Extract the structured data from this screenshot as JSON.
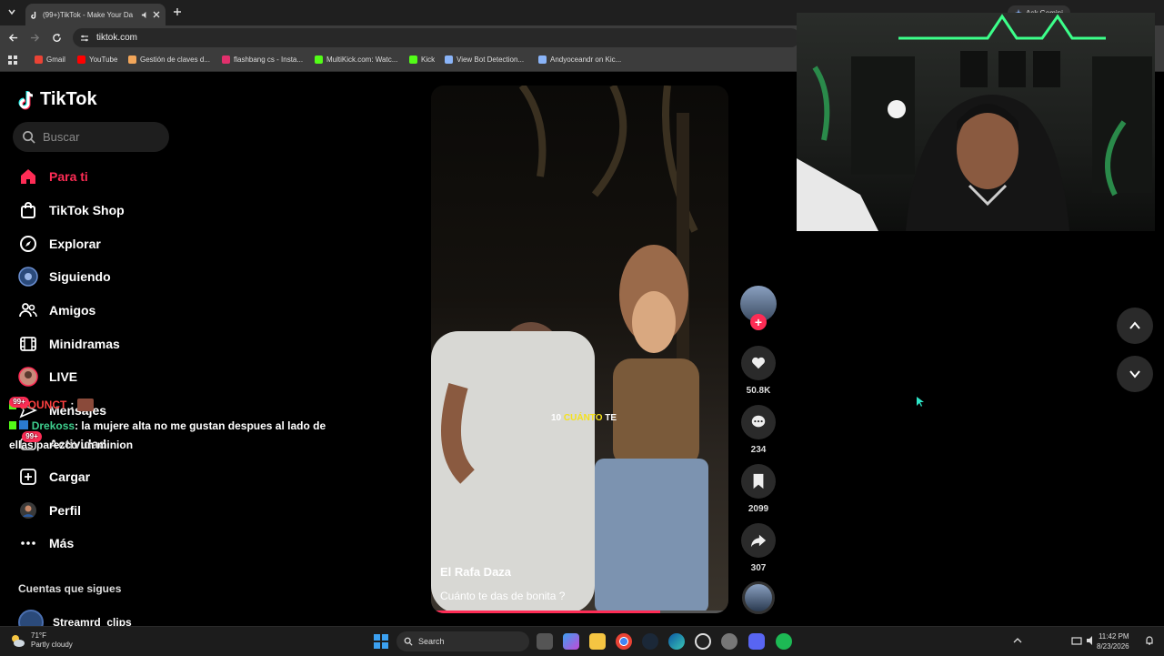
{
  "browser": {
    "tab_title": "(99+)TikTok - Make Your Da",
    "url": "tiktok.com",
    "ask_gemini": "Ask Gemini",
    "bookmarks": [
      {
        "label": "Gmail",
        "color": "#ea4335"
      },
      {
        "label": "YouTube",
        "color": "#ff0000"
      },
      {
        "label": "Gestión de claves d...",
        "color": "#f2a65a"
      },
      {
        "label": "flashbang cs - Insta...",
        "color": "#e1306c"
      },
      {
        "label": "MultiKick.com: Watc...",
        "color": "#53fc18"
      },
      {
        "label": "Kick",
        "color": "#53fc18"
      },
      {
        "label": "View Bot Detection...",
        "color": "#8ab4f8"
      },
      {
        "label": "Andyoceandr on Kic...",
        "color": "#8ab4f8"
      }
    ]
  },
  "sidebar": {
    "logo": "TikTok",
    "search_placeholder": "Buscar",
    "nav": [
      {
        "label": "Para ti",
        "icon": "home-icon"
      },
      {
        "label": "TikTok Shop",
        "icon": "shop-bag-icon"
      },
      {
        "label": "Explorar",
        "icon": "compass-icon"
      },
      {
        "label": "Siguiendo",
        "icon": "following-avatar-icon"
      },
      {
        "label": "Amigos",
        "icon": "friends-icon"
      },
      {
        "label": "Minidramas",
        "icon": "film-icon"
      },
      {
        "label": "LIVE",
        "icon": "live-avatar-icon"
      },
      {
        "label": "Mensajes",
        "icon": "message-icon"
      },
      {
        "label": "Actividad",
        "icon": "activity-icon"
      },
      {
        "label": "Cargar",
        "icon": "upload-icon"
      },
      {
        "label": "Perfil",
        "icon": "profile-icon"
      },
      {
        "label": "Más",
        "icon": "more-icon"
      }
    ],
    "badge": "99+",
    "following_title": "Cuentas que sigues",
    "following_account": "Streamrd_clips"
  },
  "chat": {
    "line1_user": "BOUNCT",
    "line2_user": "Drekoss",
    "line2_text": ": la mujere alta no me gustan despues al lado de ellas parezco un minion"
  },
  "video": {
    "author": "El Rafa Daza",
    "description": "Cuánto te das de bonita ?",
    "subtitle_a": "10",
    "subtitle_b": "CUÁNTO",
    "subtitle_c": "TE",
    "progress": 0.77
  },
  "actions": {
    "likes": "50.8K",
    "comments": "234",
    "saves": "2099",
    "shares": "307"
  },
  "taskbar": {
    "temp": "71°F",
    "weather": "Partly cloudy",
    "search": "Search",
    "time": "11:42 PM",
    "date": "8/23/2026"
  },
  "colors": {
    "accent": "#fe2c55",
    "chat_user": "#3ecf8e"
  }
}
